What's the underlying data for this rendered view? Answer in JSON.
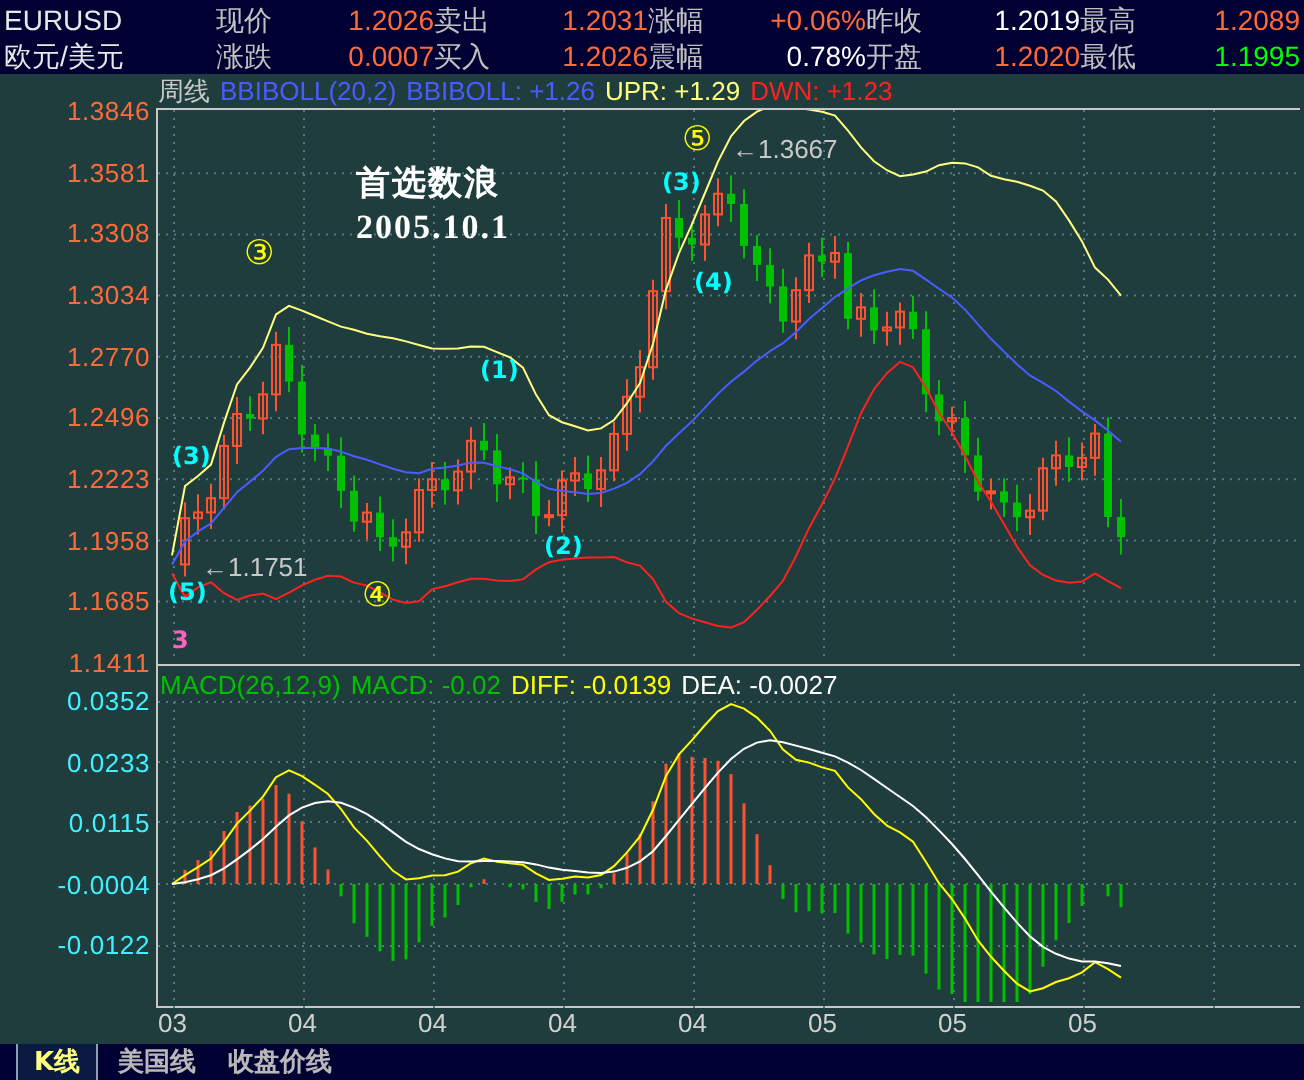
{
  "quote": {
    "rows": [
      {
        "name": "EURUSD",
        "items": [
          {
            "kind": "label",
            "text": "现价"
          },
          {
            "kind": "value",
            "text": "1.2026",
            "color": "#ff6a3a"
          },
          {
            "kind": "label",
            "text": "卖出"
          },
          {
            "kind": "value",
            "text": "1.2031",
            "color": "#ff6a3a"
          },
          {
            "kind": "label",
            "text": "涨幅"
          },
          {
            "kind": "value",
            "text": "+0.06%",
            "color": "#ff6a3a"
          },
          {
            "kind": "label",
            "text": "昨收"
          },
          {
            "kind": "value",
            "text": "1.2019",
            "color": "#ffffff"
          },
          {
            "kind": "label",
            "text": "最高"
          },
          {
            "kind": "value",
            "text": "1.2089",
            "color": "#ff6a3a"
          }
        ]
      },
      {
        "name": "欧元/美元",
        "items": [
          {
            "kind": "label",
            "text": "涨跌"
          },
          {
            "kind": "value",
            "text": "0.0007",
            "color": "#ff6a3a"
          },
          {
            "kind": "label",
            "text": "买入"
          },
          {
            "kind": "value",
            "text": "1.2026",
            "color": "#ff6a3a"
          },
          {
            "kind": "label",
            "text": "震幅"
          },
          {
            "kind": "value",
            "text": "0.78%",
            "color": "#ffffff"
          },
          {
            "kind": "label",
            "text": "开盘"
          },
          {
            "kind": "value",
            "text": "1.2020",
            "color": "#ff6a3a"
          },
          {
            "kind": "label",
            "text": "最低"
          },
          {
            "kind": "value",
            "text": "1.1995",
            "color": "#00ff00"
          }
        ]
      }
    ]
  },
  "price_chart": {
    "period": "周线",
    "legend": [
      {
        "text": "BBIBOLL(20,2)",
        "color": "#4a5cff"
      },
      {
        "text": "BBIBOLL: +1.26",
        "color": "#4a5cff"
      },
      {
        "text": "UPR: +1.29",
        "color": "#ffff80"
      },
      {
        "text": "DWN: +1.23",
        "color": "#ff2020"
      }
    ],
    "y_labels": [
      "1.3846",
      "1.3581",
      "1.3308",
      "1.3034",
      "1.2770",
      "1.2496",
      "1.2223",
      "1.1958",
      "1.1685",
      "1.1411"
    ],
    "annotations": [
      {
        "kind": "caption",
        "text": "首选数浪",
        "color": "#ffffff"
      },
      {
        "kind": "caption",
        "text": "2005.10.1",
        "color": "#ffffff"
      },
      {
        "kind": "wave",
        "text": "③",
        "color": "#ffff00"
      },
      {
        "kind": "wave",
        "text": "⑤",
        "color": "#ffff00"
      },
      {
        "kind": "wave",
        "text": "④",
        "color": "#ffff00"
      },
      {
        "kind": "wave",
        "text": "(3)",
        "color": "#00ffff"
      },
      {
        "kind": "wave",
        "text": "(5)",
        "color": "#00ffff"
      },
      {
        "kind": "wave",
        "text": "(1)",
        "color": "#00ffff"
      },
      {
        "kind": "wave",
        "text": "(2)",
        "color": "#00ffff"
      },
      {
        "kind": "wave",
        "text": "(3)",
        "color": "#00ffff"
      },
      {
        "kind": "wave",
        "text": "(4)",
        "color": "#00ffff"
      },
      {
        "kind": "wave",
        "text": "3",
        "color": "#ff60c0"
      },
      {
        "kind": "price",
        "text": "←1.3667",
        "color": "#c8c8c8"
      },
      {
        "kind": "price",
        "text": "←1.1751",
        "color": "#c8c8c8"
      }
    ]
  },
  "macd_chart": {
    "legend": [
      {
        "text": "MACD(26,12,9)",
        "color": "#00c000"
      },
      {
        "text": "MACD: -0.02",
        "color": "#00c000"
      },
      {
        "text": "DIFF: -0.0139",
        "color": "#ffff00"
      },
      {
        "text": "DEA: -0.0027",
        "color": "#ffffff"
      }
    ],
    "y_labels": [
      "0.0352",
      "0.0233",
      "0.0115",
      "-0.0004",
      "-0.0122"
    ]
  },
  "x_labels": [
    "03",
    "04",
    "04",
    "04",
    "04",
    "05",
    "05",
    "05"
  ],
  "tabs": [
    {
      "label": "K线",
      "selected": true
    },
    {
      "label": "美国线",
      "selected": false
    },
    {
      "label": "收盘价线",
      "selected": false
    }
  ]
}
